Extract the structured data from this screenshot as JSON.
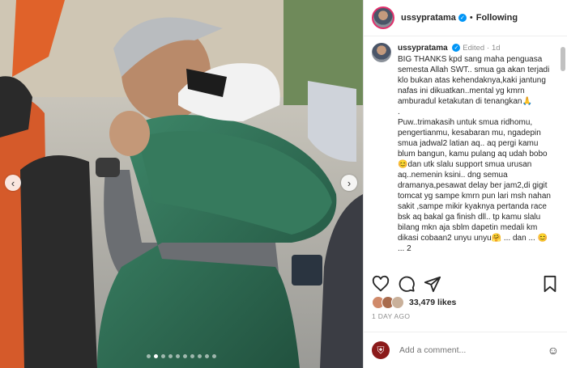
{
  "post": {
    "username": "ussypratama",
    "follow_label": "Following",
    "separator": "•",
    "edited_label": "Edited",
    "edited_sep": "·",
    "age": "1d",
    "caption": "BIG THANKS kpd sang maha penguasa semesta Allah SWT.. smua ga akan terjadi klo bukan atas kehendaknya,kaki jantung nafas ini dikuatkan..mental yg kmrn amburadul ketakutan di tenangkan🙏\n.\nPuw..trimakasih untuk smua ridhomu, pengertianmu, kesabaran mu, ngadepin smua jadwal2 latian aq.. aq pergi kamu blum bangun, kamu pulang aq udah bobo😊dan utk slalu support smua urusan aq..nemenin ksini.. dng semua dramanya,pesawat delay ber jam2,di gigit tomcat yg sampe kmrn pun lari msh nahan sakit ,sampe mikir kyaknya pertanda race bsk aq bakal ga finish dll.. tp kamu slalu bilang mkn aja sblm dapetin medali km dikasi cobaan2 unyu unyu🤗 ... dan ... 😊 ... 2",
    "likes": "33,479 likes",
    "time_ago": "1 DAY AGO",
    "comment_placeholder": "Add a comment..."
  },
  "carousel": {
    "total": 10,
    "active": 1
  },
  "icons": {
    "verified": "verified-badge-icon",
    "heart": "heart-icon",
    "comment": "comment-icon",
    "share": "share-icon",
    "save": "bookmark-icon",
    "emoji": "emoji-icon",
    "prev": "chevron-left-icon",
    "next": "chevron-right-icon"
  },
  "colors": {
    "accent": "#0095f6",
    "jacket": "#2e6b52",
    "text": "#262626",
    "muted": "#8e8e8e"
  }
}
